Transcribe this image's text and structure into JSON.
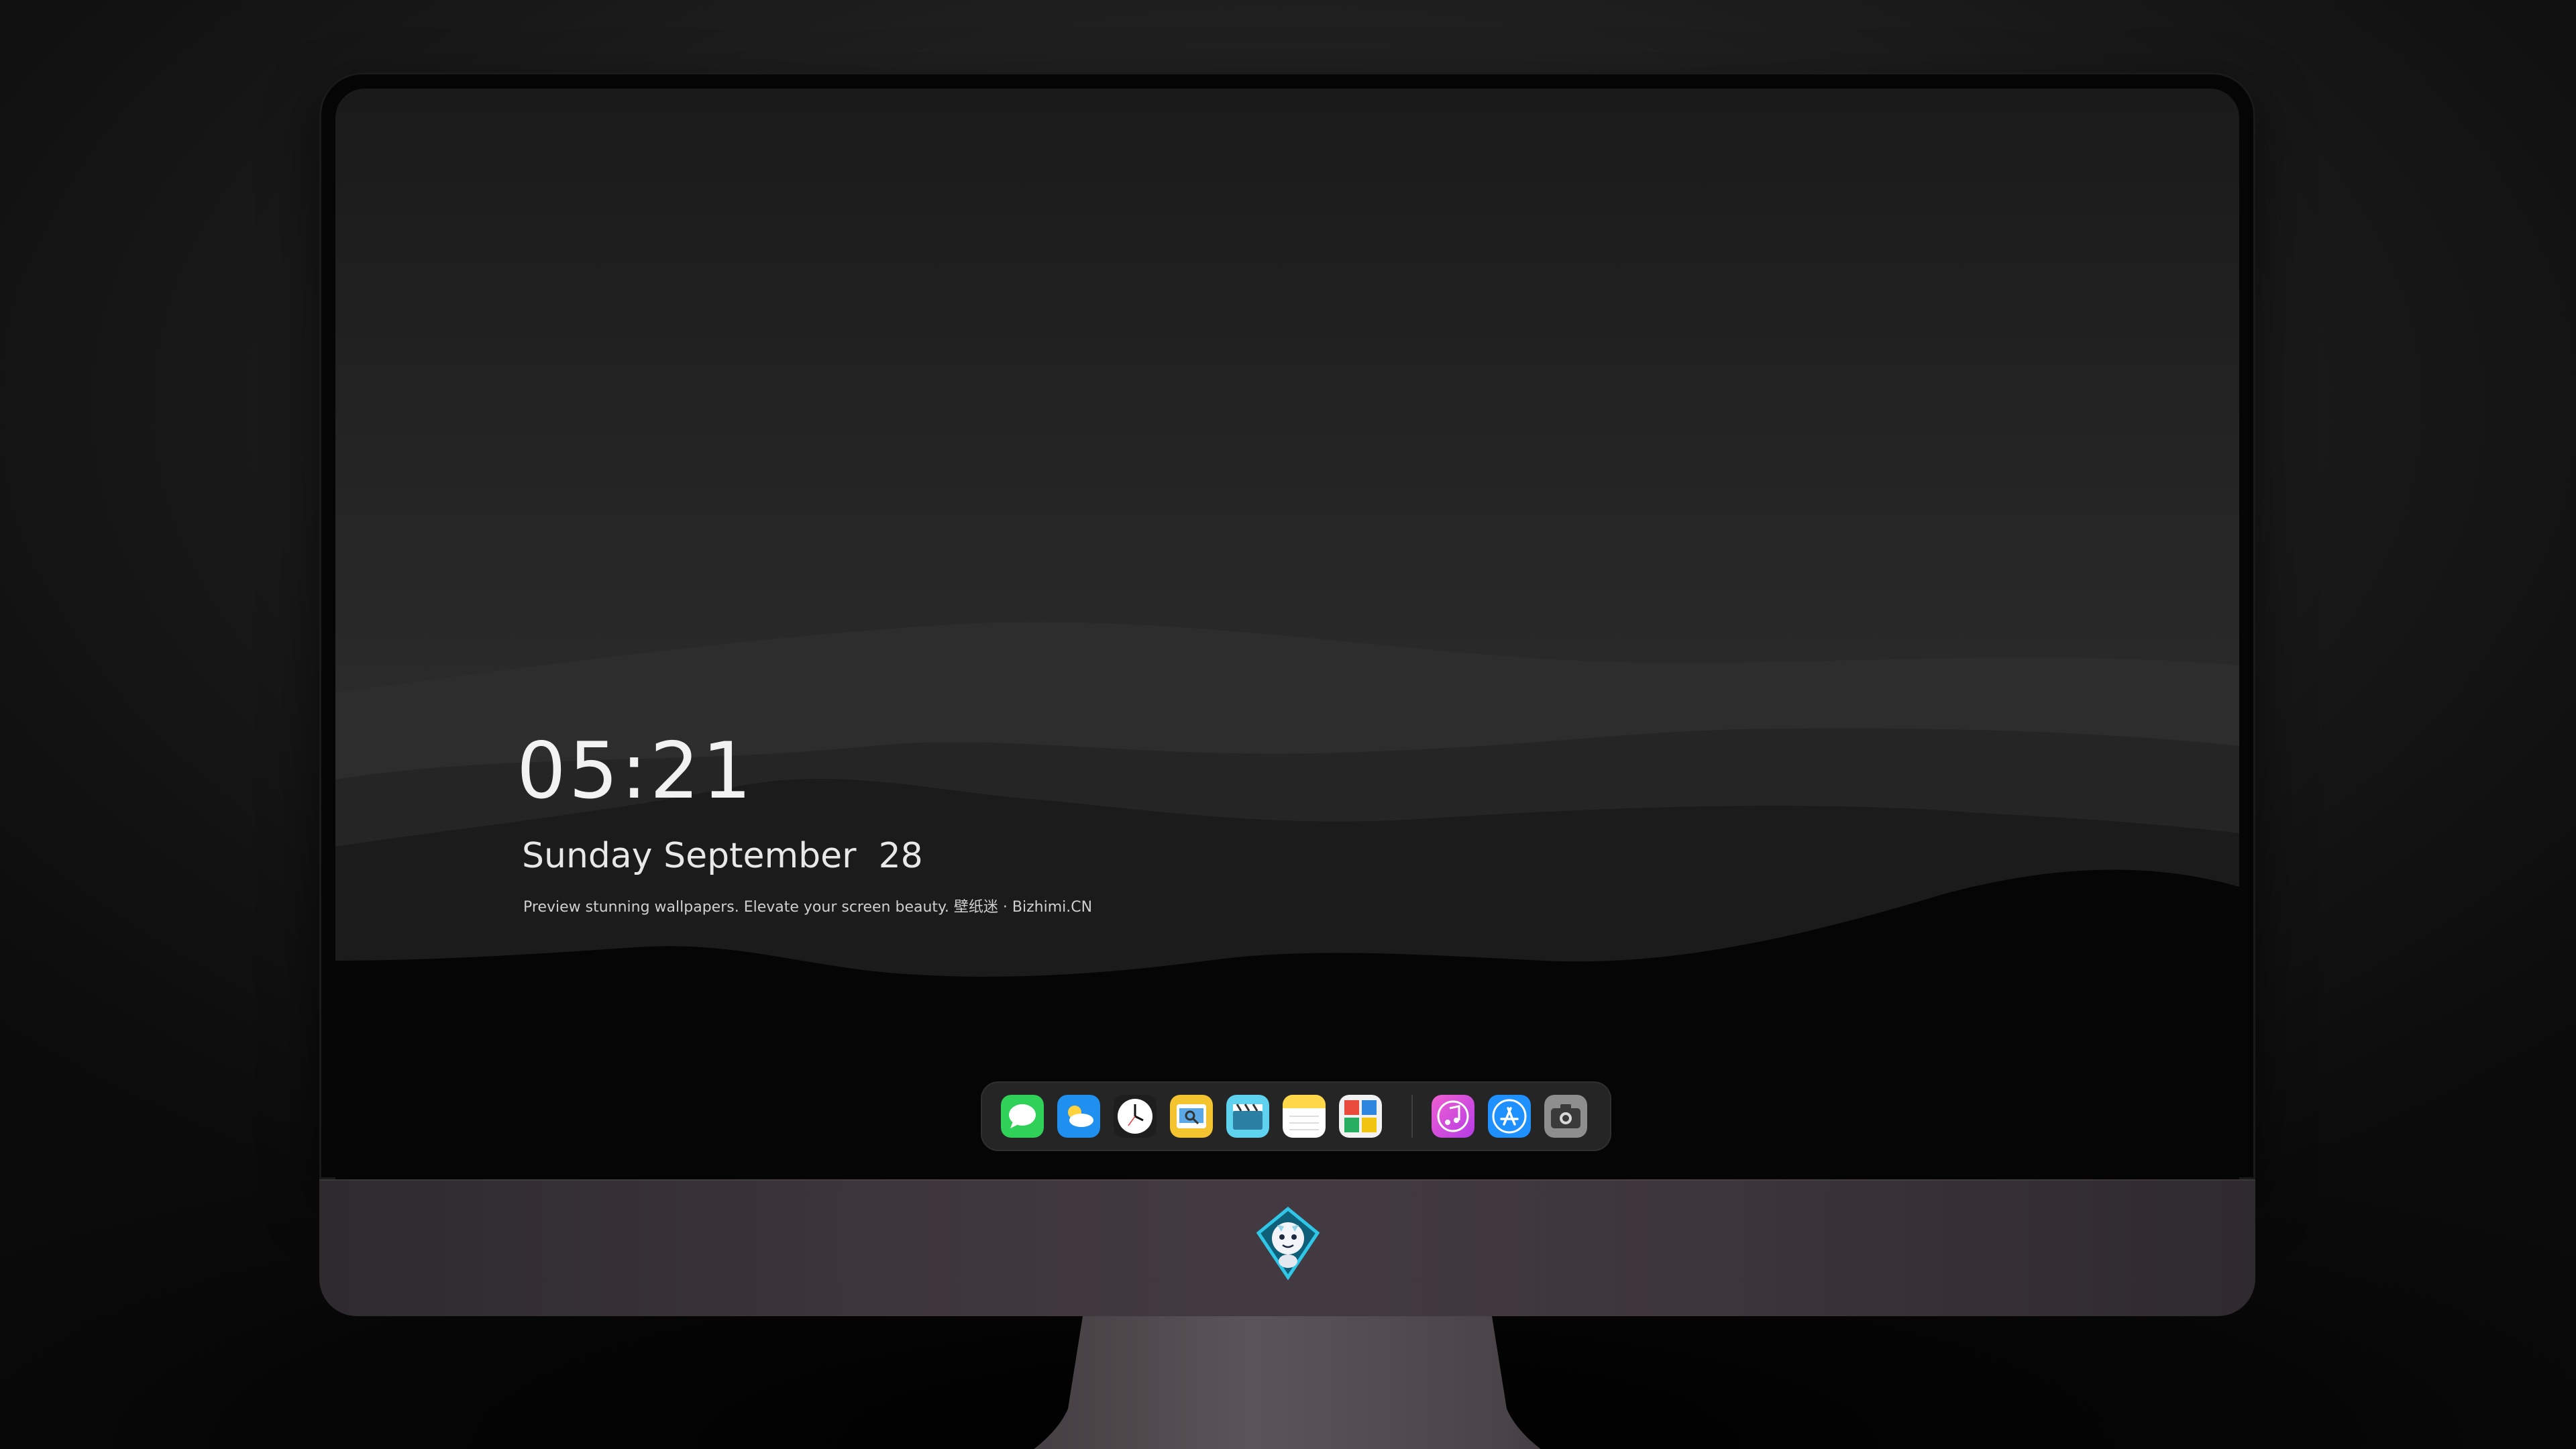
{
  "lockscreen": {
    "time": "05:21",
    "date": "Sunday September  28",
    "caption": "Preview stunning wallpapers. Elevate your screen beauty. 壁纸迷 · Bizhimi.CN"
  },
  "dock": {
    "items": [
      {
        "icon": "messages-icon",
        "color": "#2fd158"
      },
      {
        "icon": "weather-icon",
        "color": "#1f8ff0"
      },
      {
        "icon": "clock-icon",
        "color": "#ffffff"
      },
      {
        "icon": "preview-icon",
        "color": "#f4c430"
      },
      {
        "icon": "clips-icon",
        "color": "#5fd2f0"
      },
      {
        "icon": "notes-icon",
        "color": "#ffd84a"
      },
      {
        "icon": "photo-booth-icon",
        "color": "#e94b3c"
      },
      {
        "icon": "music-icon",
        "color": "#d94ce6"
      },
      {
        "icon": "app-store-icon",
        "color": "#1e90ff"
      },
      {
        "icon": "camera-icon",
        "color": "#8e8e8e"
      }
    ]
  },
  "colors": {
    "background": "#1e1e1e",
    "chin": "#3d363c",
    "text": "#f2f2f2"
  }
}
